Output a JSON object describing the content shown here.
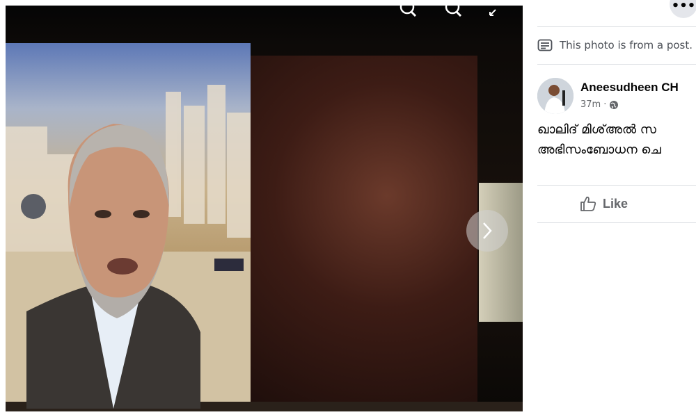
{
  "viewer": {
    "toolbar": {
      "zoom_in_icon": "zoom-in-icon",
      "zoom_out_icon": "zoom-out-icon",
      "fullscreen_icon": "fullscreen-icon"
    },
    "next_icon": "chevron-right-icon"
  },
  "post": {
    "notice": "This photo is from a post.",
    "author": "Aneesudheen CH",
    "time": "37m",
    "caption_lines": [
      "ഖാലിദ് മിശ്അൽ സ",
      "അഭിസംബോധന ചെ"
    ],
    "like_label": "Like"
  },
  "colors": {
    "panel_bg": "#ffffff",
    "text_primary": "#050505",
    "text_secondary": "#65676b",
    "viewer_bg": "#000000"
  }
}
